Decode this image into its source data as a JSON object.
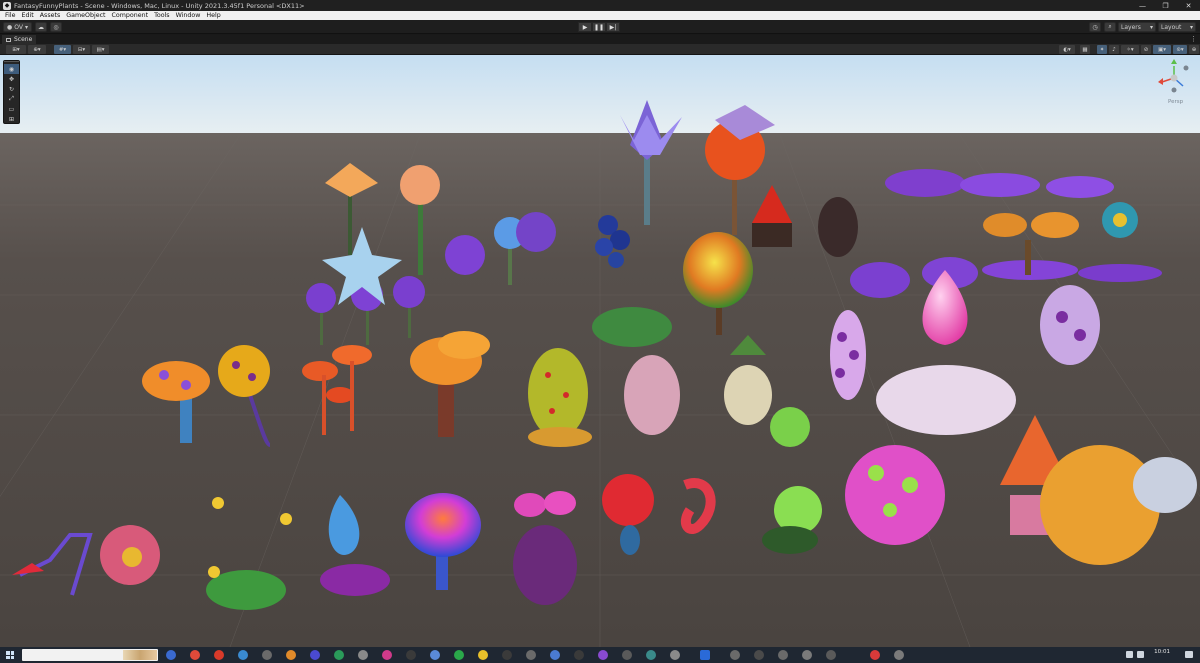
{
  "window": {
    "title": "FantasyFunnyPlants - Scene - Windows, Mac, Linux - Unity 2021.3.45f1 Personal <DX11>",
    "minimize": "—",
    "maximize": "❐",
    "close": "✕"
  },
  "menu": [
    "File",
    "Edit",
    "Assets",
    "GameObject",
    "Component",
    "Tools",
    "Window",
    "Help"
  ],
  "toolbar": {
    "account": "OV",
    "layers": "Layers",
    "layout": "Layout"
  },
  "scene": {
    "tab_label": "Scene",
    "perspective_label": "Persp"
  },
  "taskbar": {
    "time": "10:01"
  },
  "colors": {
    "editor_bg": "#191919",
    "toolbar_bg": "#1e1e1e",
    "accent_blue": "#3e5c7c",
    "sky_top": "#c8dff2",
    "ground": "#4e4844"
  }
}
